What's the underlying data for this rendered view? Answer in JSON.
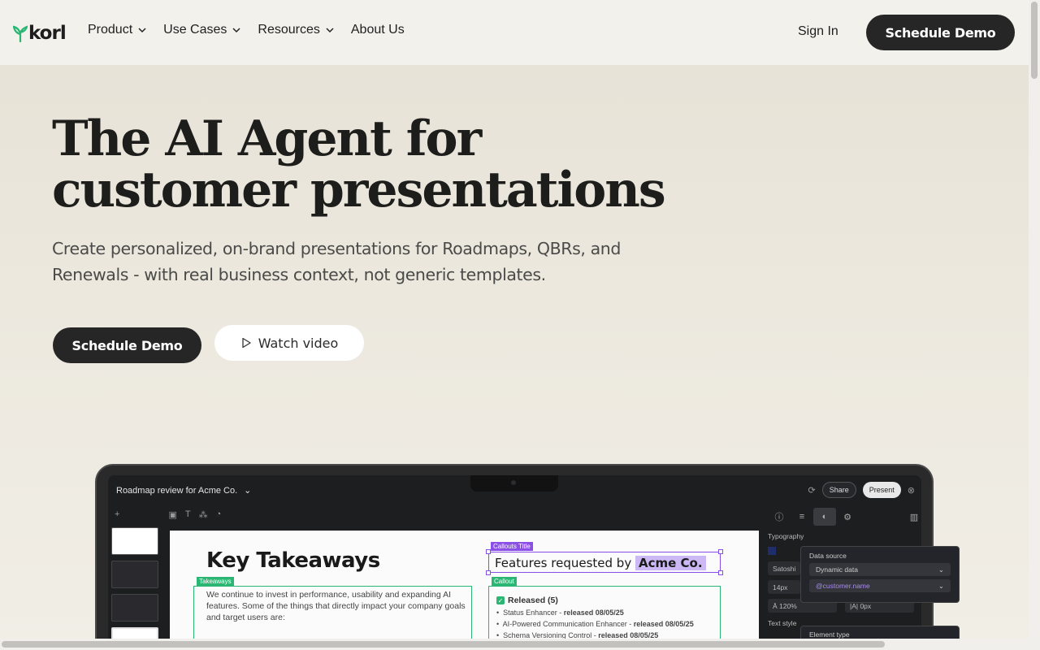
{
  "header": {
    "logo_text": "korl",
    "menu": [
      {
        "label": "Product",
        "has_dropdown": true
      },
      {
        "label": "Use Cases",
        "has_dropdown": true
      },
      {
        "label": "Resources",
        "has_dropdown": true
      },
      {
        "label": "About Us",
        "has_dropdown": false
      }
    ],
    "sign_in": "Sign In",
    "cta": "Schedule Demo"
  },
  "hero": {
    "title_line1": "The AI Agent for",
    "title_line2": "customer presentations",
    "subtitle_line1": "Create personalized, on-brand presentations for Roadmaps, QBRs, and",
    "subtitle_line2": "Renewals - with real business context, not generic templates.",
    "primary_cta": "Schedule Demo",
    "secondary_cta": "Watch video"
  },
  "app": {
    "doc_title": "Roadmap review for Acme Co.",
    "share": "Share",
    "present": "Present",
    "slide": {
      "title": "Key Takeaways",
      "takeaways_tag": "Takeaways",
      "takeaways_text": "We continue to invest in performance, usability and expanding AI features. Some of the things that directly impact your company goals and target users are:",
      "callouts_title_tag": "Callouts Title",
      "feature_prefix": "Features requested by",
      "feature_customer": "Acme Co.",
      "callout_tag": "Callout",
      "released_heading": "Released (5)",
      "released_items": [
        {
          "name": "Status Enhancer",
          "note": "released 08/05/25"
        },
        {
          "name": "AI-Powered Communication Enhancer",
          "note": "released 08/05/25"
        },
        {
          "name": "Schema Versioning Control",
          "note": "released 08/05/25"
        }
      ]
    },
    "panel": {
      "typography_label": "Typography",
      "font": "Satoshi",
      "size": "14px",
      "line_height": "120%",
      "letter_spacing": "0px",
      "text_style_label": "Text style"
    },
    "popover": {
      "label": "Data source",
      "source": "Dynamic data",
      "variable": "@customer.name",
      "element_type_label": "Element type"
    }
  },
  "colors": {
    "accent_green": "#2bb673",
    "accent_purple": "#8a4fe6",
    "dark_button": "#262626"
  }
}
